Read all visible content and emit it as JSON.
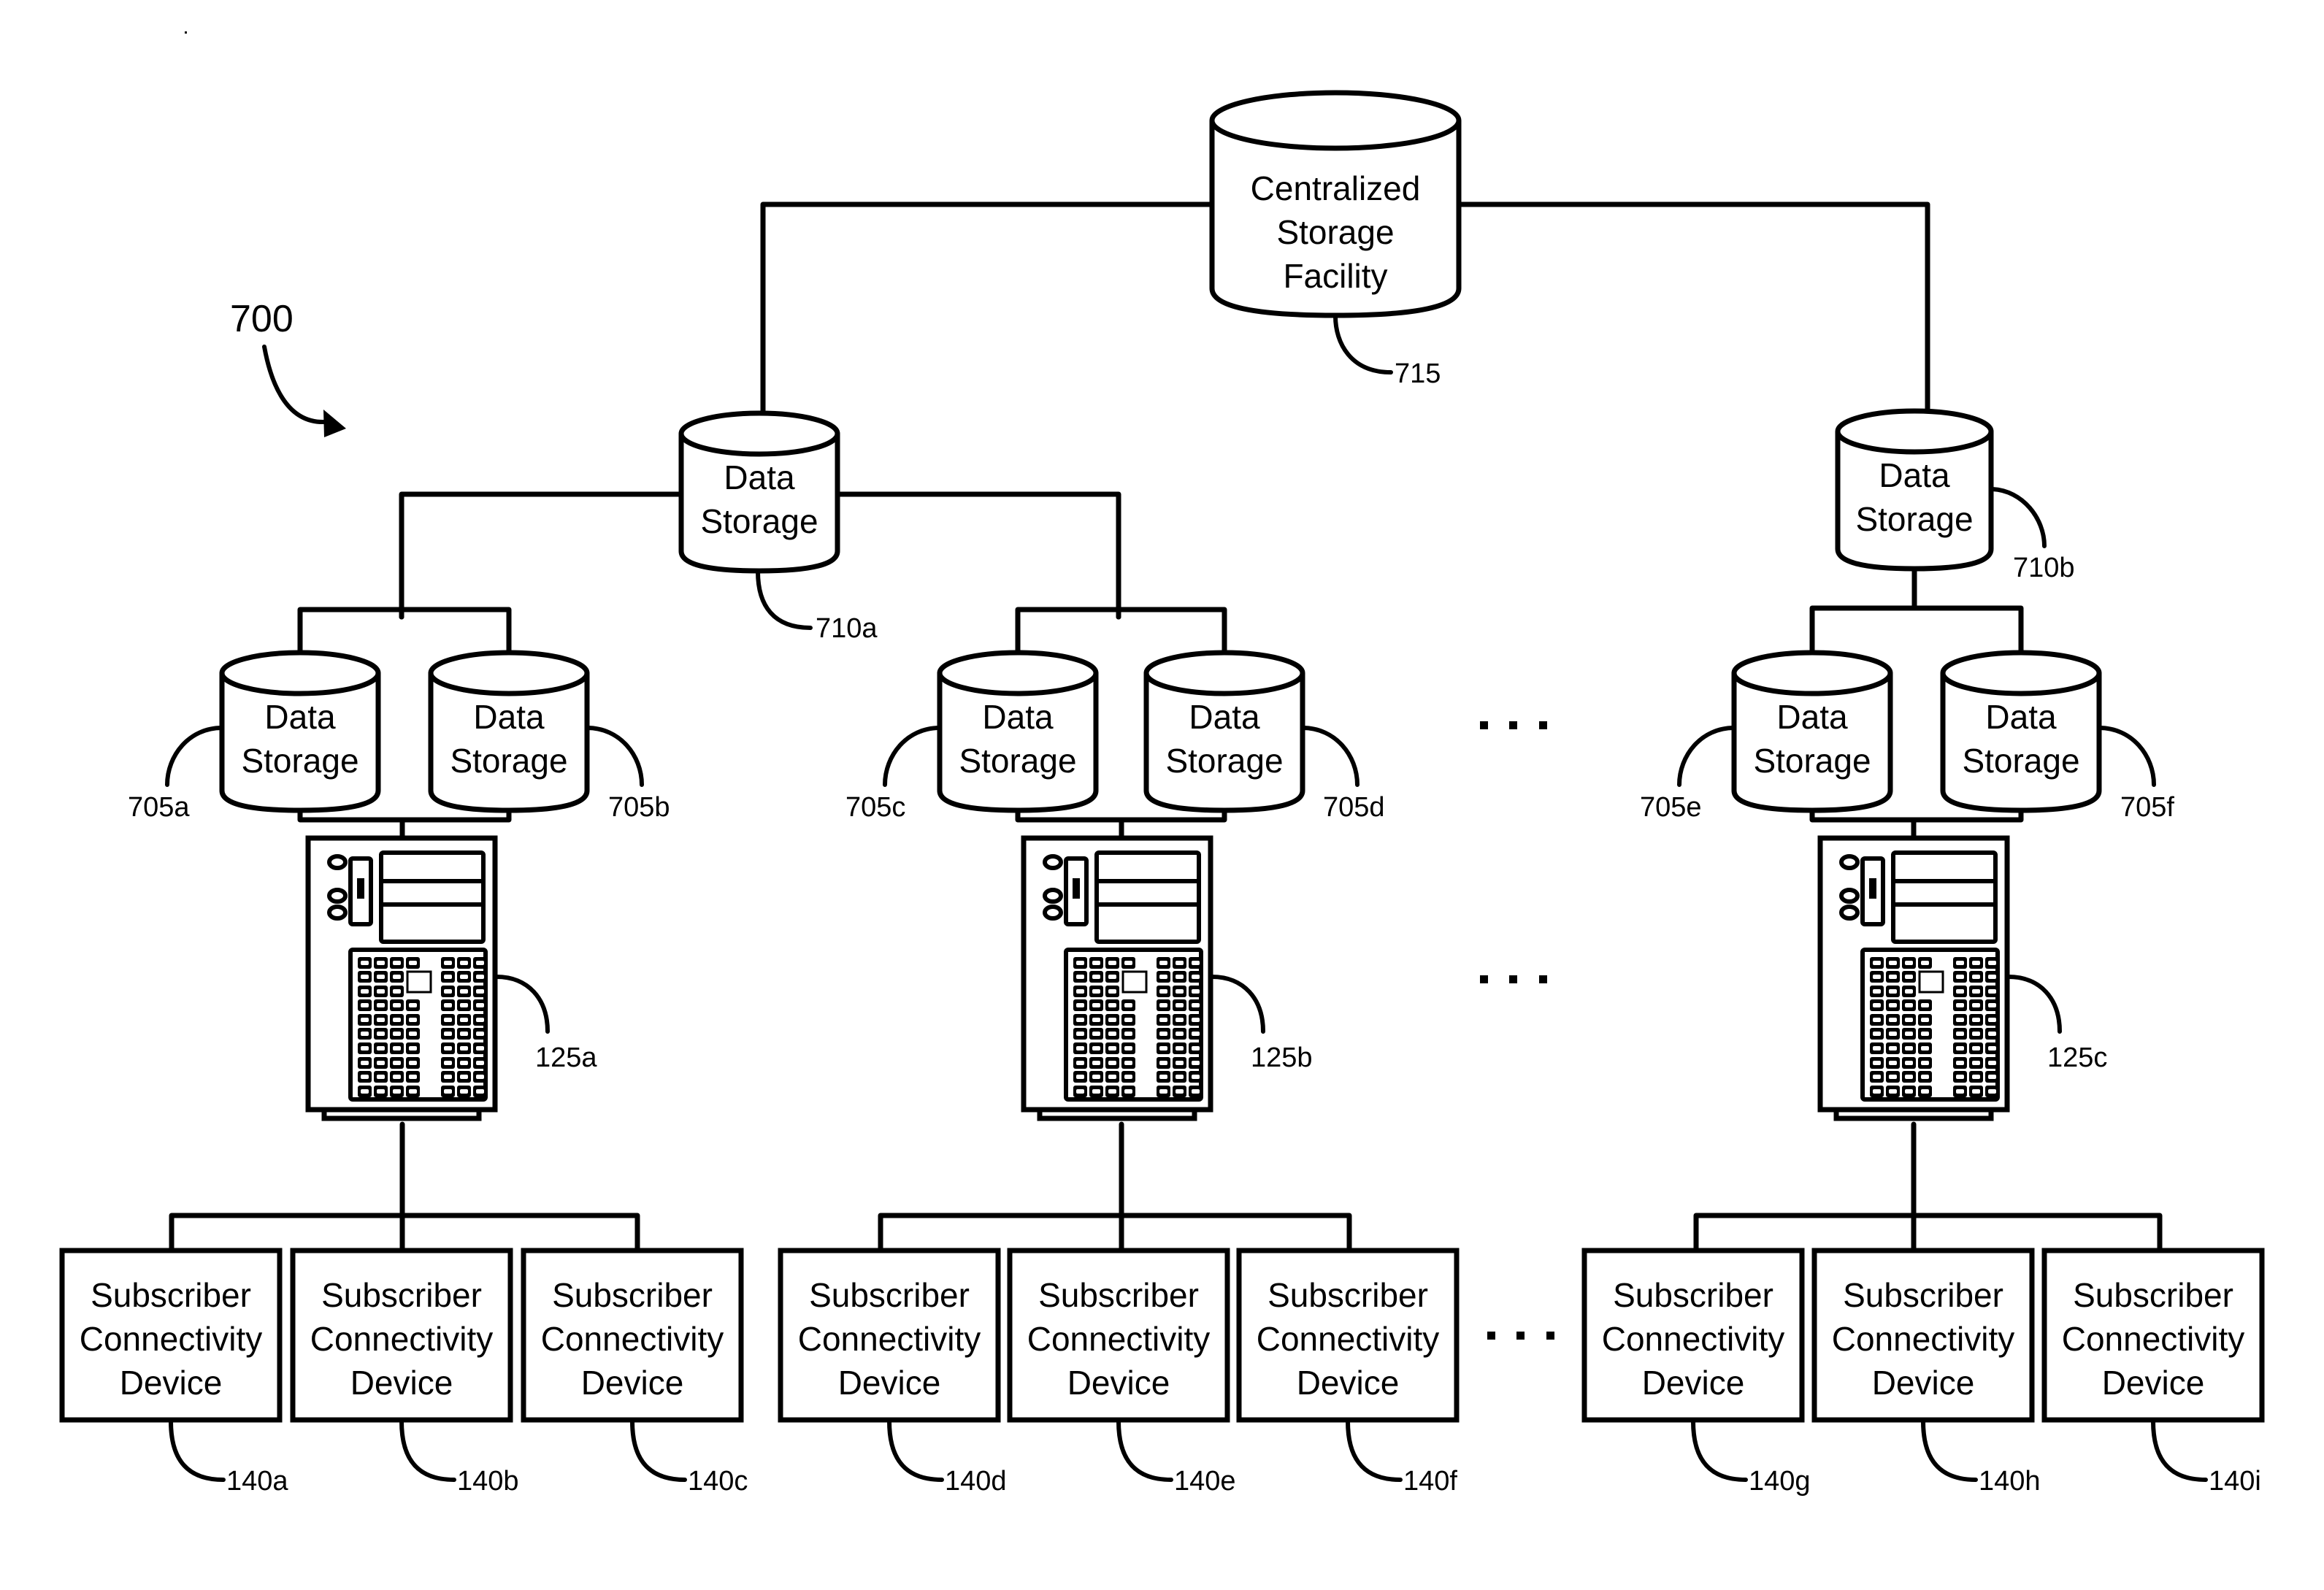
{
  "figure": {
    "number": "700",
    "arrow_icon": "curved-arrow-icon"
  },
  "centralized_storage": {
    "lines": [
      "Centralized",
      "Storage",
      "Facility"
    ],
    "ref": "715"
  },
  "regional_storage": [
    {
      "lines": [
        "Data",
        "Storage"
      ],
      "ref": "710a"
    },
    {
      "lines": [
        "Data",
        "Storage"
      ],
      "ref": "710b"
    }
  ],
  "local_storage": [
    {
      "lines": [
        "Data",
        "Storage"
      ],
      "ref": "705a"
    },
    {
      "lines": [
        "Data",
        "Storage"
      ],
      "ref": "705b"
    },
    {
      "lines": [
        "Data",
        "Storage"
      ],
      "ref": "705c"
    },
    {
      "lines": [
        "Data",
        "Storage"
      ],
      "ref": "705d"
    },
    {
      "lines": [
        "Data",
        "Storage"
      ],
      "ref": "705e"
    },
    {
      "lines": [
        "Data",
        "Storage"
      ],
      "ref": "705f"
    }
  ],
  "servers": [
    {
      "ref": "125a",
      "icon": "server-tower-icon"
    },
    {
      "ref": "125b",
      "icon": "server-tower-icon"
    },
    {
      "ref": "125c",
      "icon": "server-tower-icon"
    }
  ],
  "subscriber_devices": [
    {
      "lines": [
        "Subscriber",
        "Connectivity",
        "Device"
      ],
      "ref": "140a"
    },
    {
      "lines": [
        "Subscriber",
        "Connectivity",
        "Device"
      ],
      "ref": "140b"
    },
    {
      "lines": [
        "Subscriber",
        "Connectivity",
        "Device"
      ],
      "ref": "140c"
    },
    {
      "lines": [
        "Subscriber",
        "Connectivity",
        "Device"
      ],
      "ref": "140d"
    },
    {
      "lines": [
        "Subscriber",
        "Connectivity",
        "Device"
      ],
      "ref": "140e"
    },
    {
      "lines": [
        "Subscriber",
        "Connectivity",
        "Device"
      ],
      "ref": "140f"
    },
    {
      "lines": [
        "Subscriber",
        "Connectivity",
        "Device"
      ],
      "ref": "140g"
    },
    {
      "lines": [
        "Subscriber",
        "Connectivity",
        "Device"
      ],
      "ref": "140h"
    },
    {
      "lines": [
        "Subscriber",
        "Connectivity",
        "Device"
      ],
      "ref": "140i"
    }
  ],
  "ellipsis_icon": "ellipsis-icon"
}
